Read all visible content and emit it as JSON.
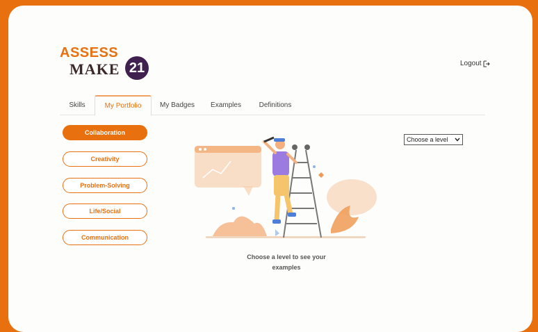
{
  "logo": {
    "line1": "ASSESS",
    "line2": "MAKE",
    "number": "21"
  },
  "header": {
    "logout_label": "Logout"
  },
  "tabs": [
    {
      "label": "Skills",
      "active": false
    },
    {
      "label": "My Portfolio",
      "active": true
    },
    {
      "label": "My Badges",
      "active": false
    },
    {
      "label": "Examples",
      "active": false
    },
    {
      "label": "Definitions",
      "active": false
    }
  ],
  "skills": [
    {
      "label": "Collaboration",
      "active": true
    },
    {
      "label": "Creativity",
      "active": false
    },
    {
      "label": "Problem-Solving",
      "active": false
    },
    {
      "label": "Life/Social",
      "active": false
    },
    {
      "label": "Communication",
      "active": false
    }
  ],
  "level_select": {
    "value": "Choose a level"
  },
  "main": {
    "caption_line1": "Choose a level to see your",
    "caption_line2": "examples"
  },
  "colors": {
    "accent": "#e8700f",
    "logo_circle": "#40204f",
    "illustration_peach": "#f6c9a3"
  }
}
